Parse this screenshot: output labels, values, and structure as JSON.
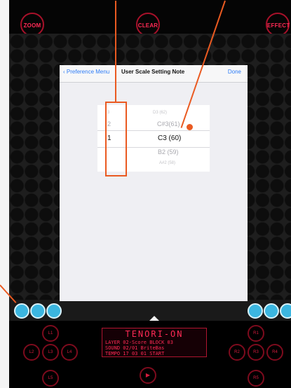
{
  "top_buttons": [
    "ZOOM",
    "CLEAR",
    "EFFECT"
  ],
  "modal": {
    "back_label": "Preference Menu",
    "title": "User Scale Setting Note",
    "done_label": "Done",
    "picker": {
      "left_column": [
        "3",
        "2",
        "1"
      ],
      "right_column": [
        "D3 (62)",
        "C#3(61)",
        "C3 (60)",
        "B2 (59)",
        "A#2 (58)"
      ],
      "selected_left": "1",
      "selected_right": "C3 (60)"
    }
  },
  "controls": {
    "left_buttons": [
      "L1",
      "L2",
      "L3",
      "L4",
      "L5"
    ],
    "right_buttons": [
      "R1",
      "R2",
      "R3",
      "R4",
      "R5"
    ],
    "play_icon": "play-icon"
  },
  "display": {
    "title": "TENORI-ON",
    "line1_tag": "LAYER",
    "line1_text": "02-Score",
    "line1_tag2": "BLOCK",
    "line1_value": "03",
    "line2_tag": "SOUND",
    "line2_text": "02/01 BriteBas",
    "line3_tag": "TEMPO",
    "line3_text": "17 03 01",
    "line3_tag2": "START"
  },
  "accent_colors": {
    "callout": "#ea5a21",
    "display_red": "#ff2a55",
    "ios_blue": "#2d7cf6",
    "circle_blue": "#3bb6e0"
  }
}
